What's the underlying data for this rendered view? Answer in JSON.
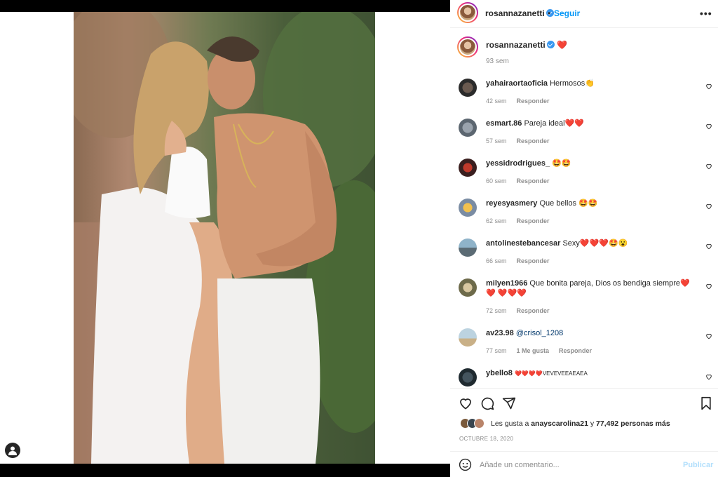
{
  "post": {
    "username": "rosannazanetti",
    "dot": "•",
    "follow_label": "Seguir",
    "more_label": "•••",
    "caption_heart": "❤️",
    "caption_time": "93 sem"
  },
  "comments": [
    {
      "user": "yahairaortaoficia",
      "text": "Hermosos👏",
      "time": "42 sem",
      "reply": "Responder",
      "likes": ""
    },
    {
      "user": "esmart.86",
      "text": "Pareja ideal❤️❤️",
      "time": "57 sem",
      "reply": "Responder",
      "likes": ""
    },
    {
      "user": "yessidrodrigues_",
      "text": "🤩🤩",
      "time": "60 sem",
      "reply": "Responder",
      "likes": ""
    },
    {
      "user": "reyesyasmery",
      "text": "Que bellos 🤩🤩",
      "time": "62 sem",
      "reply": "Responder",
      "likes": ""
    },
    {
      "user": "antolinestebancesar",
      "text": "Sexy❤️❤️❤️🤩😮",
      "time": "66 sem",
      "reply": "Responder",
      "likes": ""
    },
    {
      "user": "milyen1966",
      "text": "Que bonita pareja, Dios os bendiga siempre❤️❤️ ❤️❤️❤️",
      "time": "72 sem",
      "reply": "Responder",
      "likes": ""
    },
    {
      "user": "av23.98",
      "text": "@crisol_1208",
      "time": "77 sem",
      "reply": "Responder",
      "likes": "1 Me gusta"
    },
    {
      "user": "ybello8",
      "text": "❤️❤️❤️❤️VEVEVEEAEAEA",
      "time": "",
      "reply": "",
      "likes": ""
    }
  ],
  "likes": {
    "prefix": "Les gusta a",
    "user": "anayscarolina21",
    "middle": "y",
    "count": "77,492 personas más"
  },
  "date": "OCTUBRE 18, 2020",
  "add_comment": {
    "placeholder": "Añade un comentario...",
    "publish_label": "Publicar"
  },
  "colors": {
    "accent": "#0095f6",
    "heart": "#e0245e",
    "muted": "#8e8e8e"
  },
  "icons": [
    "heart-icon",
    "comment-icon",
    "share-icon",
    "bookmark-icon",
    "emoji-icon",
    "verified-icon",
    "user-icon"
  ]
}
